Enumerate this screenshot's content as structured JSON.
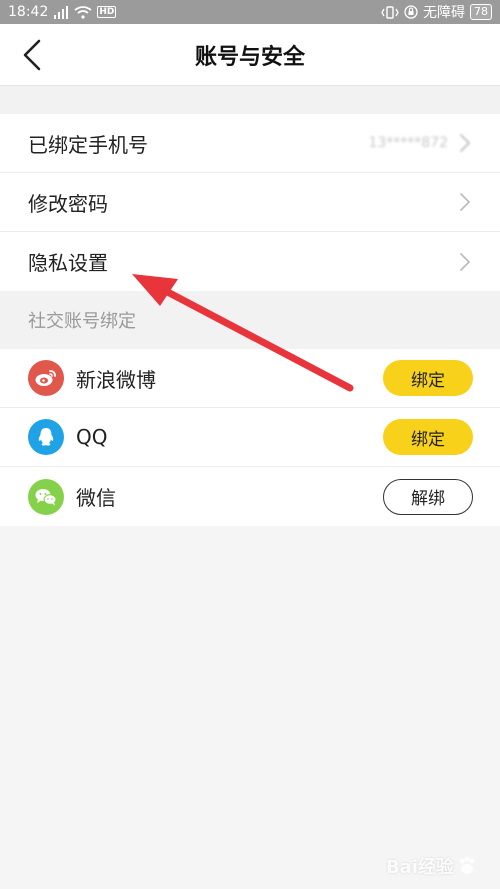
{
  "status_bar": {
    "time": "18:42",
    "hd_badge": "HD",
    "no_disturb": "无障碍",
    "battery": "78"
  },
  "navbar": {
    "title": "账号与安全",
    "back_icon": "back-chevron-icon"
  },
  "account_rows": [
    {
      "label": "已绑定手机号",
      "value": "13*****872",
      "chevron": true
    },
    {
      "label": "修改密码",
      "chevron": true
    },
    {
      "label": "隐私设置",
      "chevron": true
    }
  ],
  "social_section": {
    "header": "社交账号绑定",
    "items": [
      {
        "label": "新浪微博",
        "icon": "weibo-icon",
        "icon_color": "#e0584b",
        "button": "绑定",
        "bound": false
      },
      {
        "label": "QQ",
        "icon": "qq-icon",
        "icon_color": "#1fa3e6",
        "button": "绑定",
        "bound": false
      },
      {
        "label": "微信",
        "icon": "wechat-icon",
        "icon_color": "#86d14a",
        "button": "解绑",
        "bound": true
      }
    ]
  },
  "colors": {
    "accent_yellow": "#f8d11a",
    "annotation_arrow": "#e8353b",
    "status_bar": "#9b9b9b"
  },
  "watermark": {
    "text": "Bai经验"
  }
}
